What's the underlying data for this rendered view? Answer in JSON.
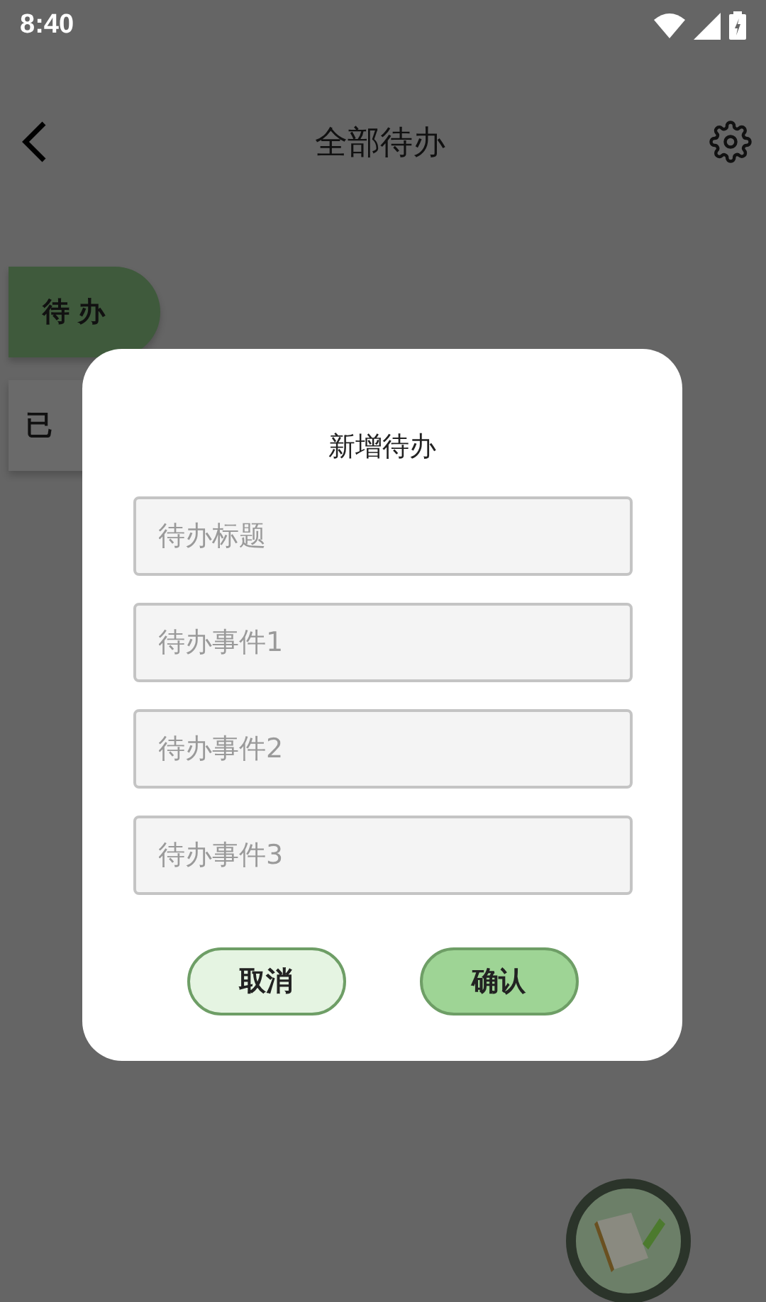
{
  "status_bar": {
    "time": "8:40"
  },
  "header": {
    "title": "全部待办"
  },
  "tabs": [
    {
      "label": "待办",
      "selected": true
    },
    {
      "label": "已",
      "selected": false
    }
  ],
  "dialog": {
    "title": "新增待办",
    "fields": [
      {
        "placeholder": "待办标题"
      },
      {
        "placeholder": "待办事件1"
      },
      {
        "placeholder": "待办事件2"
      },
      {
        "placeholder": "待办事件3"
      }
    ],
    "buttons": [
      {
        "label": "取消",
        "kind": "secondary"
      },
      {
        "label": "确认",
        "kind": "primary"
      }
    ]
  }
}
